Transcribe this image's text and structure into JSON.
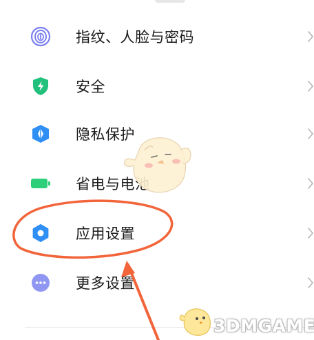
{
  "settings_menu": {
    "items": [
      {
        "label": "指纹、人脸与密码",
        "icon": "fingerprint-icon",
        "color": "#7b7ff0"
      },
      {
        "label": "安全",
        "icon": "shield-bolt-icon",
        "color": "#22c07d"
      },
      {
        "label": "隐私保护",
        "icon": "privacy-shield-icon",
        "color": "#2f8ff5"
      },
      {
        "label": "省电与电池",
        "icon": "battery-icon",
        "color": "#2ecf7a"
      },
      {
        "label": "应用设置",
        "icon": "gear-icon",
        "color": "#2f8ff5"
      },
      {
        "label": "更多设置",
        "icon": "more-dots-icon",
        "color": "#8f97f2"
      }
    ],
    "chevron": "chevron-right-icon"
  },
  "annotation": {
    "highlight_color": "#f2643a",
    "target_item": "应用设置"
  },
  "watermark": {
    "text": "3DMGAME",
    "mascot": "chick-mascot"
  }
}
